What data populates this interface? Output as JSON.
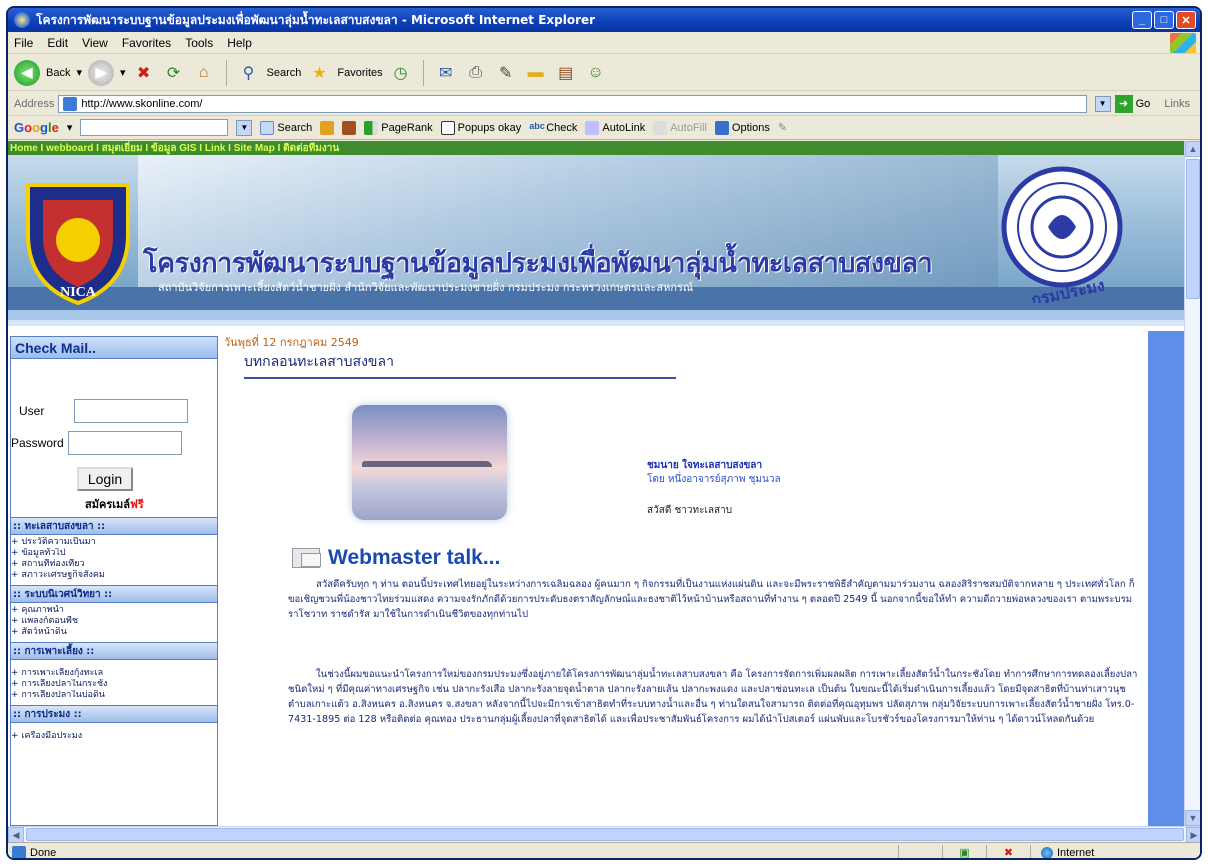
{
  "window": {
    "title": "โครงการพัฒนาระบบฐานข้อมูลประมงเพื่อพัฒนาลุ่มน้ำทะเลสาบสงขลา - Microsoft Internet Explorer",
    "minimize": "_",
    "maximize": "□",
    "close": "✕"
  },
  "menu": [
    "File",
    "Edit",
    "View",
    "Favorites",
    "Tools",
    "Help"
  ],
  "toolbar": {
    "back": "Back",
    "search": "Search",
    "favorites": "Favorites"
  },
  "address": {
    "label": "Address",
    "url": "http://www.skonline.com/",
    "go": "Go",
    "links": "Links"
  },
  "google_bar": {
    "logo_letters": [
      "G",
      "o",
      "o",
      "g",
      "l",
      "e"
    ],
    "search": "Search",
    "pagerank": "PageRank",
    "popups": "Popups okay",
    "check": "Check",
    "autolink": "AutoLink",
    "autofill": "AutoFill",
    "options": "Options"
  },
  "page": {
    "topnav": "Home   I  webboard   I  สมุดเยี่ยม  I   ข้อมูล GIS I Link     I  Site Map I ติดต่อทีมงาน",
    "banner_title": "โครงการพัฒนาระบบฐานข้อมูลประมงเพื่อพัฒนาลุ่มน้ำทะเลสาบสงขลา",
    "banner_subtitle": "สถาบันวิจัยการเพาะเลี้ยงสัตว์น้ำชายฝั่ง  สำนักวิจัยและพัฒนาประมงชายฝั่ง  กรมประมง  กระทรวงเกษตรและสหกรณ์",
    "crest_left_text": "NICA",
    "crest_right_text": "กรมประมง",
    "date": "วันพุธที่ 12 กรกฎาคม 2549",
    "article_title": "บทกลอนทะเลสาบสงขลา",
    "article_link": "ชมนาย ใจทะเลสาบสงขลา",
    "article_author": "โดย  หนึ่งอาจารย์สุภาพ  ชุมนวล",
    "article_note": "สวัสดี ชาวทะเลสาบ",
    "webmaster_title": "Webmaster talk...",
    "para1": "สวัสดีครับทุก ๆ ท่าน ตอนนี้ประเทศไทยอยู่ในระหว่างการเฉลิมฉลอง ผู้คนมาก ๆ กิจกรรมที่เป็นงานแห่งแผ่นดิน และจะมีพระราชพิธีสำคัญตามมาร่วมงาน ฉลองสิริราชสมบัติจากหลาย ๆ ประเทศทั่วโลก ก็ขอเชิญชวนพี่น้องชาวไทยร่วมแสดง ความจงรักภักดีด้วยการประดับธงตราสัญลักษณ์และธงชาติไว้หน้าบ้านหรือสถานที่ทำงาน ๆ ตลอดปี 2549 นี้  นอกจากนี้ขอให้ทำ ความดีถวายพ่อหลวงของเรา ตามพระบรมราโชวาท ราชดำรัส มาใช้ในการดำเนินชีวิตของทุกท่านไป",
    "para2": "ในช่วงนี้ผมขอแนะนำโครงการใหม่ของกรมประมงซึ่งอยู่ภายใต้โครงการพัฒนาลุ่มน้ำทะเลสาบสงขลา คือ โครงการจัดการเพิ่มผลผลิต การเพาะเลี้ยงสัตว์น้ำในกระชังโดย ทำการศึกษาการทดลองเลี้ยงปลาชนิดใหม่ ๆ ที่มีคุณค่าทางเศรษฐกิจ เช่น ปลากะรังเสือ ปลากะรังลายจุดน้ำตาล ปลากะรังลายเส้น ปลากะพงแดง และปลาช่อนทะเล เป็นต้น ในขณะนี้ได้เริ่มดำเนินการเลี้ยงแล้ว โดยมีจุดสาธิตที่บ้านท่าเสาวนุช ตำบลเกาะแต้ว อ.สิงหนคร อ.สิงหนคร จ.สงขลา หลังจากนี้ไปจะมีการเข้าสาธิตทำที่ระบบทางน้ำและอื่น ๆ ท่านใดสนใจสามารถ ติดต่อที่คุณอุทุมพร ปลัดสุภาพ กลุ่มวิจัยระบบการเพาะเลี้ยงสัตว์น้ำชายฝั่ง โทร.0-7431-1895 ต่อ 128 หรือติดต่อ คุณทอง ประธานกลุ่มผู้เลี้ยงปลาที่จุดสาธิตได้ และเพื่อประชาสัมพันธ์โครงการ ผมได้นำโปสเตอร์ แผ่นพับและโบรชัวร์ของโครงการมาให้ท่าน ๆ ได้ดาวน์โหลดกันด้วย"
  },
  "sidebar": {
    "check_mail": "Check Mail..",
    "user_label": "User",
    "password_label": "Password",
    "login": "Login",
    "register": "สมัครเมล์",
    "register_free": "ฟรี",
    "sections": [
      {
        "title": ":: ทะเลสาบสงขลา ::",
        "items": [
          "+ ประวัติความเป็นมา",
          "+ ข้อมูลทั่วไป",
          "+ สถานที่ท่องเที่ยว",
          "+ สภาวะเศรษฐกิจสังคม"
        ]
      },
      {
        "title": ":: ระบบนิเวศน์วิทยา ::",
        "items": [
          "+ คุณภาพน้ำ",
          "+ แพลงก์ตอนพืช",
          "+ สัตว์หน้าดิน"
        ]
      },
      {
        "title": ":: การเพาะเลี้ยง ::",
        "items": [
          "+ การเพาะเลี้ยงกุ้งทะเล",
          "+ การเลี้ยงปลาในกระชัง",
          "+ การเลี้ยงปลาในบ่อดิน"
        ]
      },
      {
        "title": ":: การประมง ::",
        "items": [
          "+ เครื่องมือประมง"
        ]
      }
    ]
  },
  "status": {
    "text": "Done",
    "zone": "Internet"
  },
  "colors": {
    "titlebar": "#0b3fb7",
    "nav_green": "#3f8c2f",
    "banner_title": "#2b3aa5",
    "sidebar_header": "#9cbcec"
  }
}
